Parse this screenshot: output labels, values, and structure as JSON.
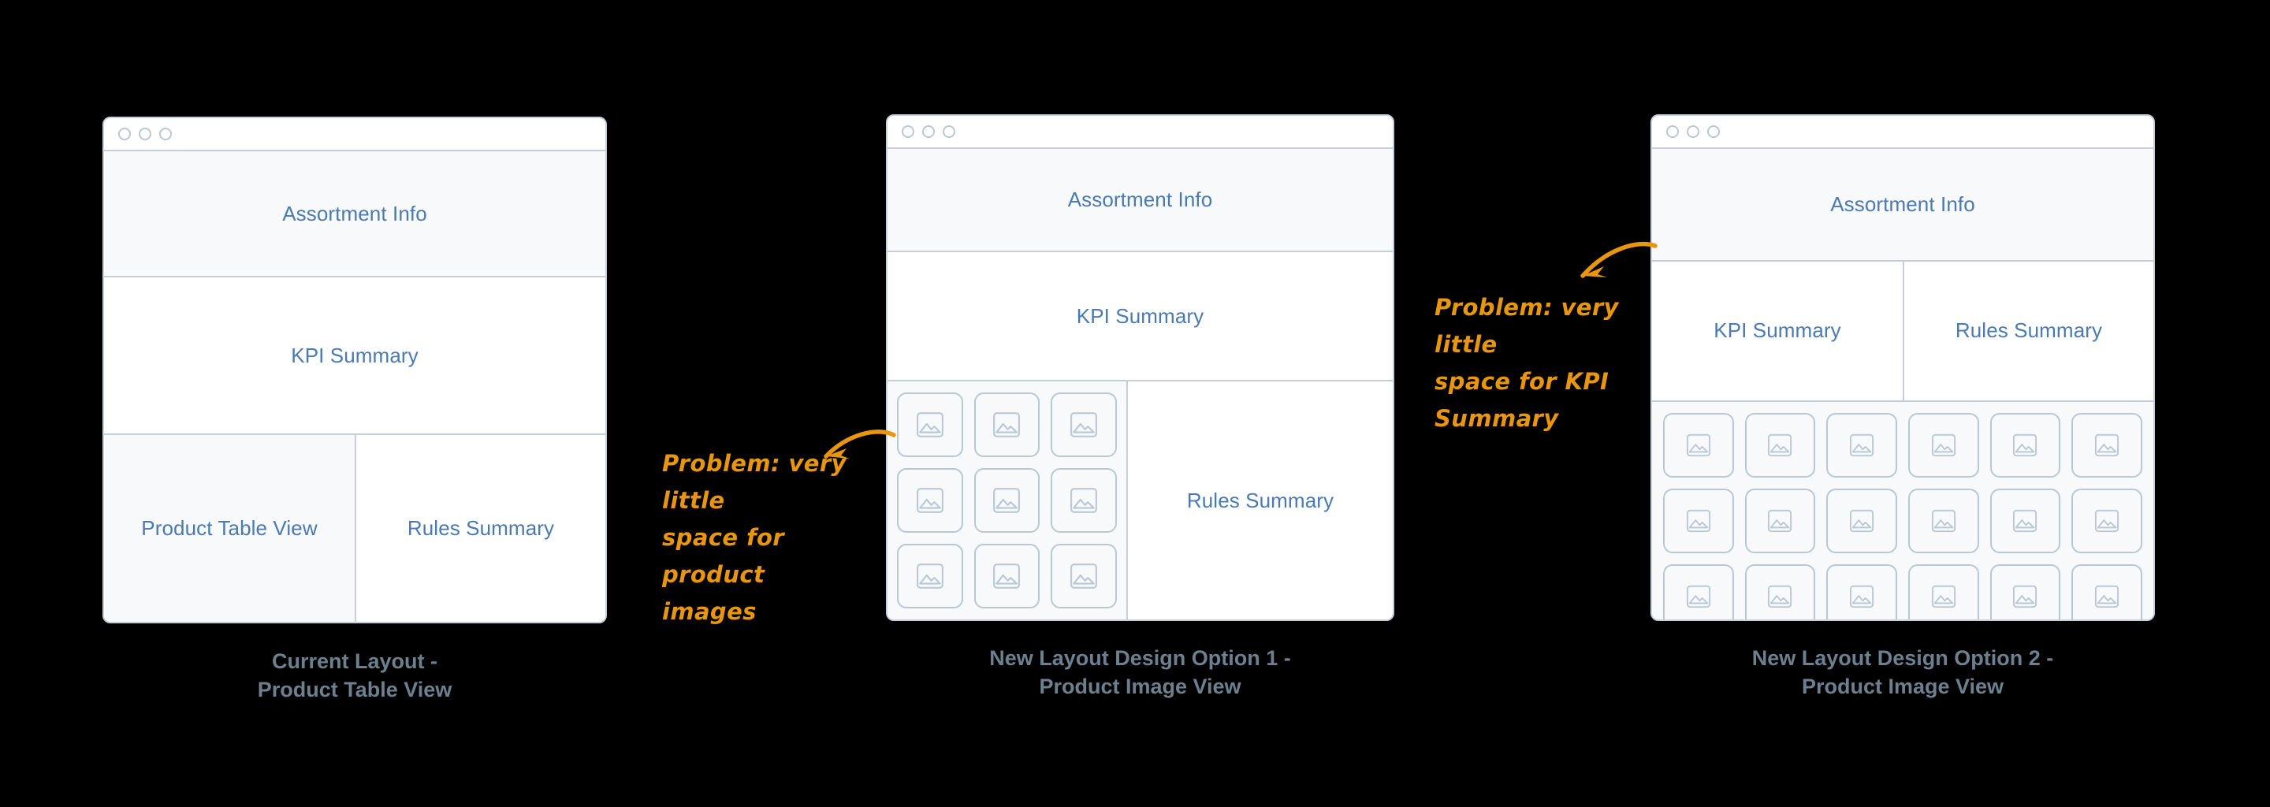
{
  "theme": {
    "background": "#000000",
    "panel_border": "#c3cfdb",
    "panel_tint": "#f8f9fa",
    "panel_white": "#ffffff",
    "region_label_color": "#4a7ab0",
    "caption_color": "#6d808f",
    "annotation_color": "#e8960f"
  },
  "panels": [
    {
      "id": "current-layout",
      "caption": "Current Layout -\nProduct Table View",
      "window_controls": [
        "close-circle",
        "minimize-circle",
        "maximize-circle"
      ],
      "regions": {
        "assortment_info": "Assortment Info",
        "kpi_summary": "KPI Summary",
        "product_table_view": "Product Table View",
        "rules_summary": "Rules Summary"
      }
    },
    {
      "id": "option-1",
      "caption": "New Layout Design Option 1 -\nProduct Image View",
      "window_controls": [
        "close-circle",
        "minimize-circle",
        "maximize-circle"
      ],
      "regions": {
        "assortment_info": "Assortment Info",
        "kpi_summary": "KPI Summary",
        "rules_summary": "Rules Summary"
      },
      "image_grid": {
        "columns": 3,
        "rows": 3,
        "item_icon": "image-placeholder-icon"
      }
    },
    {
      "id": "option-2",
      "caption": "New Layout Design Option 2 -\nProduct Image View",
      "window_controls": [
        "close-circle",
        "minimize-circle",
        "maximize-circle"
      ],
      "regions": {
        "assortment_info": "Assortment Info",
        "kpi_summary": "KPI Summary",
        "rules_summary": "Rules Summary"
      },
      "image_grid": {
        "columns": 6,
        "rows": 3,
        "item_icon": "image-placeholder-icon"
      }
    }
  ],
  "annotations": [
    {
      "id": "problem-product-images",
      "text": "Problem: very little\nspace for product\nimages",
      "points_to": "option-1 product image grid"
    },
    {
      "id": "problem-kpi-summary",
      "text": "Problem: very little\nspace for KPI\nSummary",
      "points_to": "option-2 KPI Summary region"
    }
  ]
}
